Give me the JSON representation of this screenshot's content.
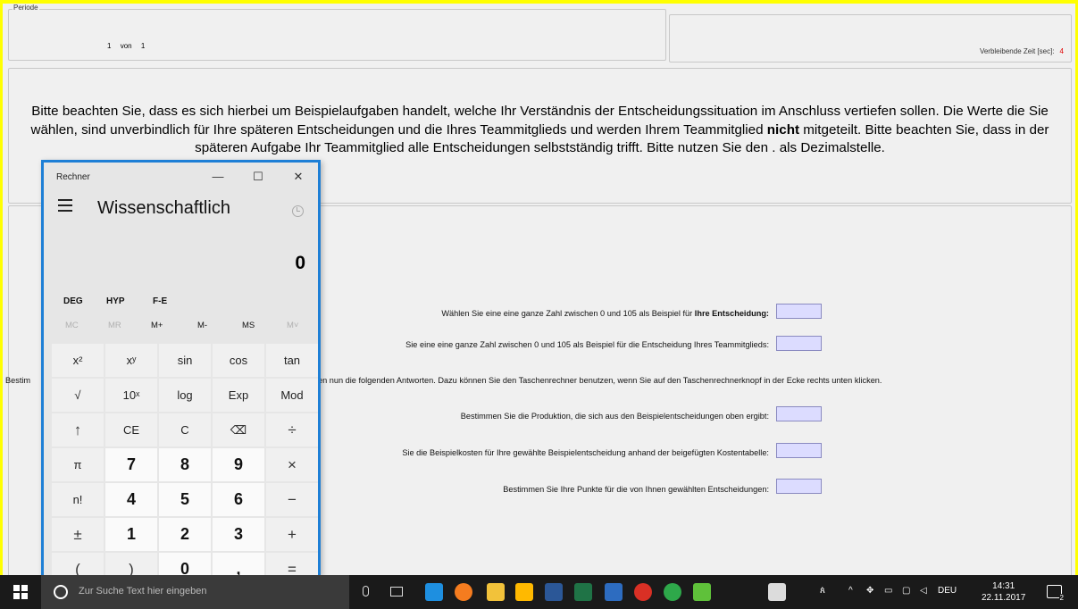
{
  "periode": {
    "legend": "Periode",
    "current": "1",
    "sep": "von",
    "total": "1"
  },
  "time": {
    "label": "Verbleibende Zeit [sec]:",
    "value": "4"
  },
  "info": {
    "p1": "Bitte beachten Sie, dass es sich hierbei um Beispielaufgaben handelt, welche Ihr Verständnis der Entscheidungssituation im Anschluss vertiefen sollen. Die Werte die Sie wählen, sind unverbindlich für Ihre späteren Entscheidungen und die Ihres Teammitglieds und werden Ihrem Teammitglied ",
    "bold": "nicht",
    "p2": " mitgeteilt. Bitte beachten Sie, dass in der späteren Aufgabe Ihr Teammitglied alle Entscheidungen selbstständig trifft. Bitte nutzen Sie den . als Dezimalstelle."
  },
  "questions": {
    "q1_text": "Wählen Sie eine eine ganze Zahl zwischen 0 und 105 als Beispiel für ",
    "q1_bold": "Ihre Entscheidung:",
    "q2": "Sie eine eine ganze Zahl zwischen 0 und 105 als Beispiel für die Entscheidung Ihres Teammitglieds:",
    "q3_left": "Bestim",
    "q3": "en nun die folgenden Antworten. Dazu können Sie den Taschenrechner benutzen, wenn Sie auf den Taschenrechnerknopf in der Ecke rechts unten klicken.",
    "q4": "Bestimmen Sie die Produktion, die sich aus den Beispielentscheidungen oben ergibt:",
    "q5": "Sie die Beispielkosten für Ihre gewählte Beispielentscheidung anhand der beigefügten Kostentabelle:",
    "q6": "Bestimmen Sie Ihre Punkte für die von Ihnen gewählten Entscheidungen:"
  },
  "calculator": {
    "title": "Rechner",
    "minimize": "—",
    "maximize": "☐",
    "close": "✕",
    "mode": "Wissenschaftlich",
    "display": "0",
    "modes": [
      "DEG",
      "HYP",
      "F-E"
    ],
    "memory": [
      "MC",
      "MR",
      "M+",
      "M-",
      "MS",
      "M˅"
    ],
    "keys": [
      [
        "x²",
        "xʸ",
        "sin",
        "cos",
        "tan"
      ],
      [
        "√",
        "10ˣ",
        "log",
        "Exp",
        "Mod"
      ],
      [
        "↑",
        "CE",
        "C",
        "⌫",
        "÷"
      ],
      [
        "π",
        "7",
        "8",
        "9",
        "×"
      ],
      [
        "n!",
        "4",
        "5",
        "6",
        "−"
      ],
      [
        "±",
        "1",
        "2",
        "3",
        "+"
      ],
      [
        "(",
        ")",
        "0",
        ",",
        "="
      ]
    ]
  },
  "taskbar": {
    "search_placeholder": "Zur Suche Text hier eingeben",
    "lang": "DEU",
    "time": "14:31",
    "date": "22.11.2017",
    "notifications": "2",
    "apps": [
      "edge-icon",
      "firefox-icon",
      "explorer-icon",
      "store-icon",
      "word-icon",
      "excel-icon",
      "powershell-icon",
      "chrome-icon",
      "green-app-icon",
      "leaf-app-icon",
      "calculator-icon"
    ],
    "app_colors": [
      "#1e8fe0",
      "#f57c1f",
      "#f2c23a",
      "#ffb900",
      "#2b5797",
      "#1f7346",
      "#2d6cc0",
      "#d93025",
      "#2ea84a",
      "#5fc13a",
      "#dcdcdc"
    ]
  }
}
